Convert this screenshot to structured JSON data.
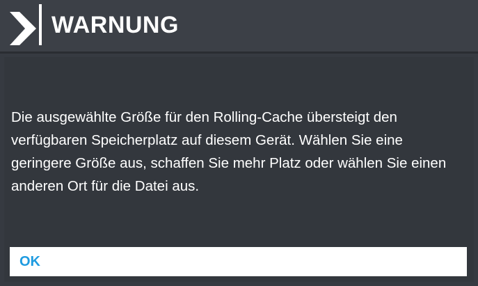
{
  "dialog": {
    "title": "WARNUNG",
    "message": "Die ausgewählte Größe für den Rolling-Cache übersteigt den verfügbaren Speicherplatz auf diesem Gerät. Wählen Sie eine geringere Größe aus, schaffen Sie mehr Platz oder wählen Sie einen anderen Ort für die Datei aus.",
    "ok_label": "OK",
    "header_icon": "chevron-right-icon"
  },
  "colors": {
    "background": "#363a41",
    "header": "#3c4047",
    "text": "#ffffff",
    "button_bg": "#ffffff",
    "button_text": "#1e9be0"
  }
}
